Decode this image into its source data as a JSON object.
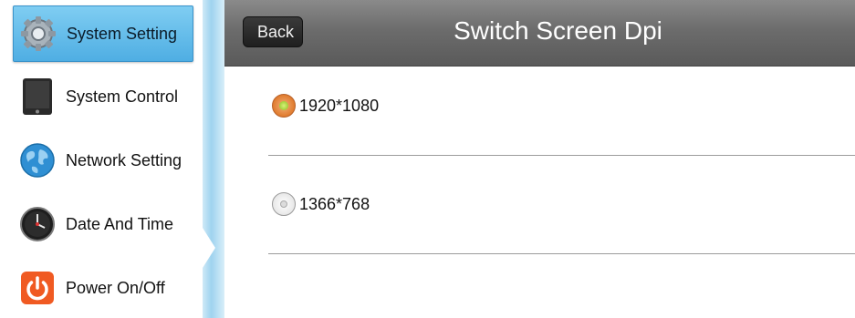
{
  "sidebar": {
    "items": [
      {
        "label": "System Setting",
        "icon": "gear-icon",
        "active": true
      },
      {
        "label": "System Control",
        "icon": "tablet-icon",
        "active": false
      },
      {
        "label": "Network Setting",
        "icon": "globe-icon",
        "active": false
      },
      {
        "label": "Date And Time",
        "icon": "clock-icon",
        "active": false
      },
      {
        "label": "Power On/Off",
        "icon": "power-icon",
        "active": false
      }
    ]
  },
  "header": {
    "back_label": "Back",
    "title": "Switch Screen Dpi"
  },
  "options": [
    {
      "label": "1920*1080",
      "selected": true
    },
    {
      "label": "1366*768",
      "selected": false
    }
  ],
  "colors": {
    "active_item": "#5bb8e8",
    "header": "#6c6c6c",
    "radio_selected": "#e07b2e"
  }
}
